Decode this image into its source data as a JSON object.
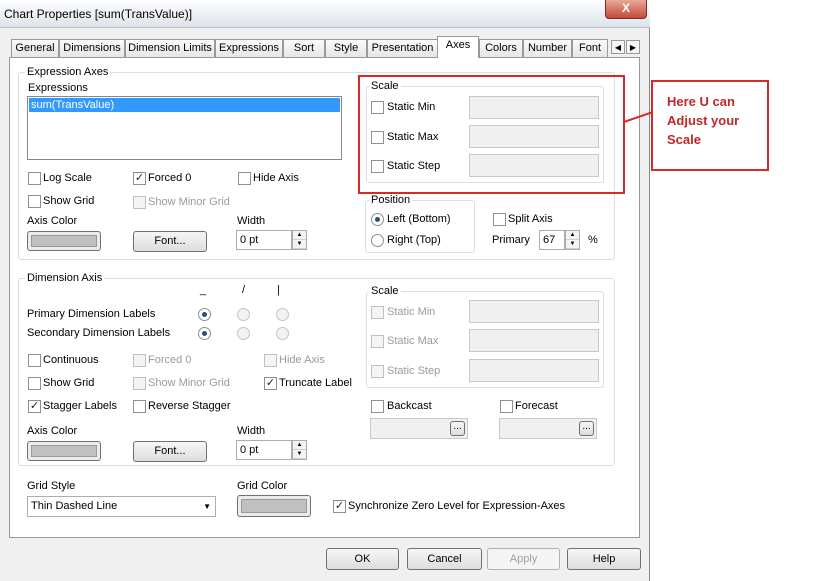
{
  "window": {
    "title": "Chart Properties [sum(TransValue)]",
    "close_glyph": "X"
  },
  "tabs": [
    "General",
    "Dimensions",
    "Dimension Limits",
    "Expressions",
    "Sort",
    "Style",
    "Presentation",
    "Axes",
    "Colors",
    "Number",
    "Font"
  ],
  "active_tab": "Axes",
  "expression_axes": {
    "group_label": "Expression Axes",
    "expressions_label": "Expressions",
    "expressions": [
      "sum(TransValue)"
    ],
    "log_scale": "Log Scale",
    "forced0": "Forced 0",
    "hide_axis": "Hide Axis",
    "show_grid": "Show Grid",
    "show_minor_grid": "Show Minor Grid",
    "axis_color": "Axis Color",
    "font_button": "Font...",
    "width_label": "Width",
    "width_value": "0 pt",
    "scale": {
      "label": "Scale",
      "static_min": "Static Min",
      "static_max": "Static Max",
      "static_step": "Static Step"
    },
    "position": {
      "label": "Position",
      "left": "Left (Bottom)",
      "right": "Right (Top)"
    },
    "split_axis": "Split Axis",
    "primary_label": "Primary",
    "primary_value": "67",
    "percent": "%"
  },
  "dimension_axis": {
    "group_label": "Dimension Axis",
    "orient_headers": [
      "_",
      "/",
      "|"
    ],
    "primary_labels": "Primary Dimension Labels",
    "secondary_labels": "Secondary Dimension Labels",
    "continuous": "Continuous",
    "forced0": "Forced 0",
    "hide_axis": "Hide Axis",
    "show_grid": "Show Grid",
    "show_minor_grid": "Show Minor Grid",
    "truncate_label": "Truncate Label",
    "stagger_labels": "Stagger Labels",
    "reverse_stagger": "Reverse Stagger",
    "axis_color": "Axis Color",
    "font_button": "Font...",
    "width_label": "Width",
    "width_value": "0 pt",
    "scale": {
      "label": "Scale",
      "static_min": "Static Min",
      "static_max": "Static Max",
      "static_step": "Static Step"
    },
    "backcast": "Backcast",
    "forecast": "Forecast",
    "ellipsis": "..."
  },
  "grid": {
    "style_label": "Grid Style",
    "style_value": "Thin Dashed Line",
    "color_label": "Grid Color",
    "sync_zero": "Synchronize Zero Level for Expression-Axes"
  },
  "buttons": {
    "ok": "OK",
    "cancel": "Cancel",
    "apply": "Apply",
    "help": "Help"
  },
  "annotation": {
    "text": "Here U can\nAdjust your\nScale",
    "color": "#d42a2a"
  },
  "icons": {
    "check": "✓",
    "up": "▲",
    "down": "▼",
    "left": "◀",
    "right": "▶",
    "dropdown": "▼"
  }
}
